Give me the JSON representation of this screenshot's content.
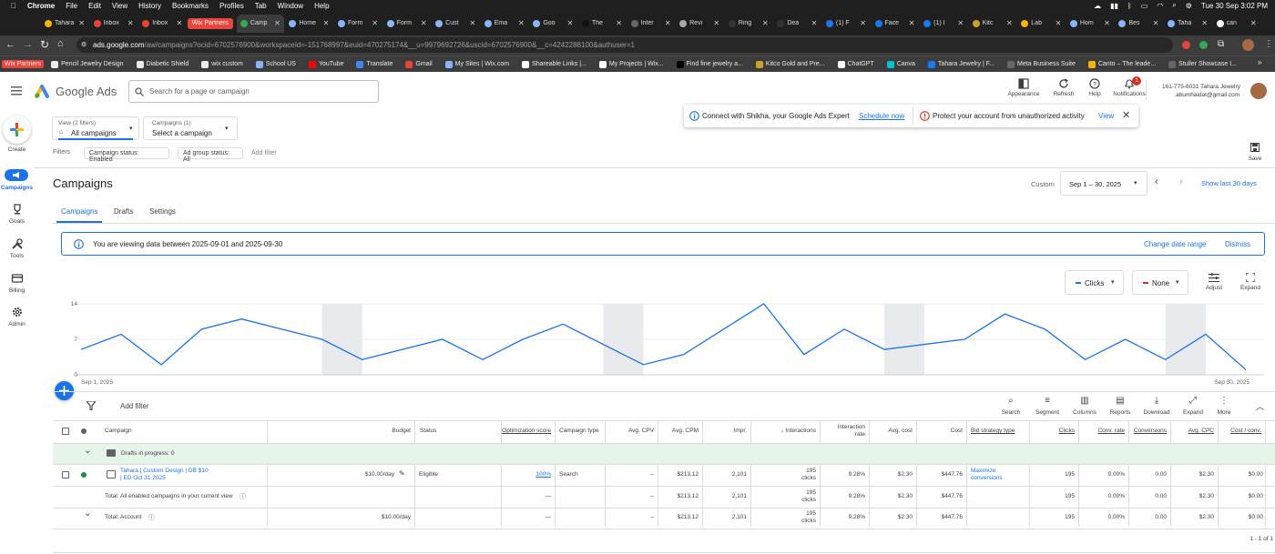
{
  "mac_menu": {
    "apple": "",
    "app": "Chrome",
    "items": [
      "File",
      "Edit",
      "View",
      "History",
      "Bookmarks",
      "Profiles",
      "Tab",
      "Window",
      "Help"
    ],
    "clock": "Tue 30 Sep  3:02 PM"
  },
  "tabs": [
    {
      "label": "Tahara",
      "color": "#f5b400"
    },
    {
      "label": "Inbox",
      "color": "#ea4335"
    },
    {
      "label": "Inbox",
      "color": "#ea4335"
    },
    {
      "label": "Wix Partners",
      "color": "#e8453c"
    },
    {
      "label": "Camp",
      "color": "#34a853",
      "active": true
    },
    {
      "label": "Home",
      "color": "#8ab4f8"
    },
    {
      "label": "Form",
      "color": "#8ab4f8"
    },
    {
      "label": "Form",
      "color": "#8ab4f8"
    },
    {
      "label": "Cust",
      "color": "#8ab4f8"
    },
    {
      "label": "Ema",
      "color": "#8ab4f8"
    },
    {
      "label": "Goo",
      "color": "#8ab4f8"
    },
    {
      "label": "The",
      "color": "#111111"
    },
    {
      "label": "Inter",
      "color": "#666666"
    },
    {
      "label": "Revi",
      "color": "#aaaaaa"
    },
    {
      "label": "Ring",
      "color": "#333333"
    },
    {
      "label": "Dea",
      "color": "#333333"
    },
    {
      "label": "(1) F",
      "color": "#1877f2"
    },
    {
      "label": "Face",
      "color": "#1877f2"
    },
    {
      "label": "(1) I",
      "color": "#1877f2"
    },
    {
      "label": "Kitc",
      "color": "#c9a227"
    },
    {
      "label": "Lab",
      "color": "#f5b400"
    },
    {
      "label": "Hom",
      "color": "#8ab4f8"
    },
    {
      "label": "Bes",
      "color": "#8ab4f8"
    },
    {
      "label": "Taha",
      "color": "#8ab4f8"
    },
    {
      "label": "can",
      "color": "#ffffff"
    }
  ],
  "address": {
    "url_host": "ads.google.com",
    "url_path": "/aw/campaigns?ocid=6702576900&workspaceId=-151768997&euid=470275174&__u=9979692726&uscid=6702576900&__c=4242288100&authuser=1"
  },
  "bookmarks": [
    {
      "label": "Wix Partners",
      "color": "#e8453c",
      "wix": true
    },
    {
      "label": "Pencil Jewelry Design",
      "color": "#e8eaed"
    },
    {
      "label": "Diabetic Shield",
      "color": "#e8eaed"
    },
    {
      "label": "wix custom",
      "color": "#e8eaed"
    },
    {
      "label": "School US",
      "color": "#8ab4f8"
    },
    {
      "label": "YouTube",
      "color": "#ff0000"
    },
    {
      "label": "Translate",
      "color": "#4285f4"
    },
    {
      "label": "Gmail",
      "color": "#ea4335"
    },
    {
      "label": "My Sites | Wix.com",
      "color": "#8ab4f8"
    },
    {
      "label": "Shareable Links |...",
      "color": "#ffffff"
    },
    {
      "label": "My Projects | Wix...",
      "color": "#ffffff"
    },
    {
      "label": "Find fine jewelry a...",
      "color": "#000000"
    },
    {
      "label": "Kitco Gold and Pre...",
      "color": "#c9a227"
    },
    {
      "label": "ChatGPT",
      "color": "#ffffff"
    },
    {
      "label": "Canva",
      "color": "#00c4cc"
    },
    {
      "label": "Tahara Jewelry | F...",
      "color": "#1877f2"
    },
    {
      "label": "Meta Business Suite",
      "color": "#666666"
    },
    {
      "label": "Canto – The leade...",
      "color": "#f5b400"
    },
    {
      "label": "Stuller Showcase I...",
      "color": "#666666"
    }
  ],
  "header": {
    "product": "Google Ads",
    "search_placeholder": "Search for a page or campaign",
    "icons": [
      "Appearance",
      "Refresh",
      "Help",
      "Notifications"
    ],
    "notif_count": "1",
    "account_id": "161-775-6031 Tahara Jewelry",
    "account_email": "abumhaidat@gmail.com"
  },
  "leftnav": [
    {
      "label": "Create",
      "icon": "plus-icon"
    },
    {
      "label": "Campaigns",
      "icon": "megaphone-icon",
      "active": true
    },
    {
      "label": "Goals",
      "icon": "trophy-icon"
    },
    {
      "label": "Tools",
      "icon": "tools-icon"
    },
    {
      "label": "Billing",
      "icon": "card-icon"
    },
    {
      "label": "Admin",
      "icon": "gear-icon"
    }
  ],
  "view_selector": {
    "top": "View (2 filters)",
    "main": "All campaigns"
  },
  "campaign_selector": {
    "top": "Campaigns (1)",
    "main": "Select a campaign"
  },
  "filters": {
    "label": "Filters",
    "chips": [
      "Campaign status: Enabled",
      "Ad group status: All"
    ],
    "add": "Add filter"
  },
  "notifications": {
    "left_text": "Connect with Shikha, your Google Ads Expert",
    "left_link": "Schedule now",
    "right_text": "Protect your account from unauthorized activity",
    "right_link": "View"
  },
  "save_label": "Save",
  "page": {
    "title": "Campaigns",
    "custom_label": "Custom",
    "date_range": "Sep 1 – 30, 2025",
    "show_last": "Show last 30 days",
    "tabs": [
      "Campaigns",
      "Drafts",
      "Settings"
    ]
  },
  "info_banner": {
    "text": "You are viewing data between 2025-09-01 and 2025-09-30",
    "change": "Change date range",
    "dismiss": "Dismiss"
  },
  "chart_controls": {
    "metric1": "Clicks",
    "metric1_color": "#1a73e8",
    "metric2": "None",
    "metric2_color": "#d93025",
    "adjust": "Adjust",
    "expand": "Expand"
  },
  "chart_data": {
    "type": "line",
    "series": [
      {
        "name": "Clicks",
        "color": "#1a73e8",
        "values": [
          5,
          8,
          2,
          9,
          11,
          9,
          7,
          3,
          5,
          7,
          3,
          7,
          10,
          6,
          2,
          4,
          9,
          14,
          4,
          9,
          5,
          6,
          7,
          12,
          9,
          3,
          7,
          3,
          8,
          1
        ]
      }
    ],
    "x_labels": [
      "Sep 1, 2025",
      "Sep 30, 2025"
    ],
    "y_ticks": [
      0,
      7,
      14
    ],
    "ylim": [
      0,
      14
    ],
    "weekend_bands": [
      [
        6,
        7
      ],
      [
        13,
        14
      ],
      [
        20,
        21
      ],
      [
        27,
        28
      ]
    ]
  },
  "table_toolbar": {
    "add_filter": "Add filter",
    "icons": [
      "Search",
      "Segment",
      "Columns",
      "Reports",
      "Download",
      "Expand",
      "More"
    ]
  },
  "table": {
    "headers": [
      "Campaign",
      "Budget",
      "Status",
      "Optimization score",
      "Campaign type",
      "Avg. CPV",
      "Avg. CPM",
      "Impr.",
      "Interactions",
      "Interaction rate",
      "Avg. cost",
      "Cost",
      "Bid strategy type",
      "Clicks",
      "Conv. rate",
      "Conversions",
      "Avg. CPC",
      "Cost / conv."
    ],
    "drafts": "Drafts in progress: 0",
    "rows": [
      {
        "name": "Tahara | Custom Design | DB $10 | ED Oct 31 2025",
        "budget": "$10.00/day",
        "status": "Eligible",
        "opt": "100%",
        "type": "Search",
        "cpv": "–",
        "cpm": "$213.12",
        "impr": "2,101",
        "inter": "195",
        "inter2": "clicks",
        "rate": "9.28%",
        "avgcost": "$2.30",
        "cost": "$447.76",
        "bid": "Maximize conversions",
        "clicks": "195",
        "convrate": "0.00%",
        "conv": "0.00",
        "cpc": "$2.30",
        "costconv": "$0.00"
      },
      {
        "name": "Total: All enabled campaigns in your current view",
        "budget": "",
        "status": "",
        "opt": "—",
        "type": "",
        "cpv": "–",
        "cpm": "$213.12",
        "impr": "2,101",
        "inter": "195",
        "inter2": "clicks",
        "rate": "9.28%",
        "avgcost": "$2.30",
        "cost": "$447.76",
        "bid": "",
        "clicks": "195",
        "convrate": "0.00%",
        "conv": "0.00",
        "cpc": "$2.30",
        "costconv": "$0.00"
      },
      {
        "name": "Total: Account",
        "budget": "$10.00/day",
        "status": "",
        "opt": "—",
        "type": "",
        "cpv": "–",
        "cpm": "$213.12",
        "impr": "2,101",
        "inter": "195",
        "inter2": "clicks",
        "rate": "9.28%",
        "avgcost": "$2.30",
        "cost": "$447.76",
        "bid": "",
        "clicks": "195",
        "convrate": "0.00%",
        "conv": "0.00",
        "cpc": "$2.30",
        "costconv": "$0.00"
      }
    ],
    "pagination": "1 - 1 of 1"
  }
}
